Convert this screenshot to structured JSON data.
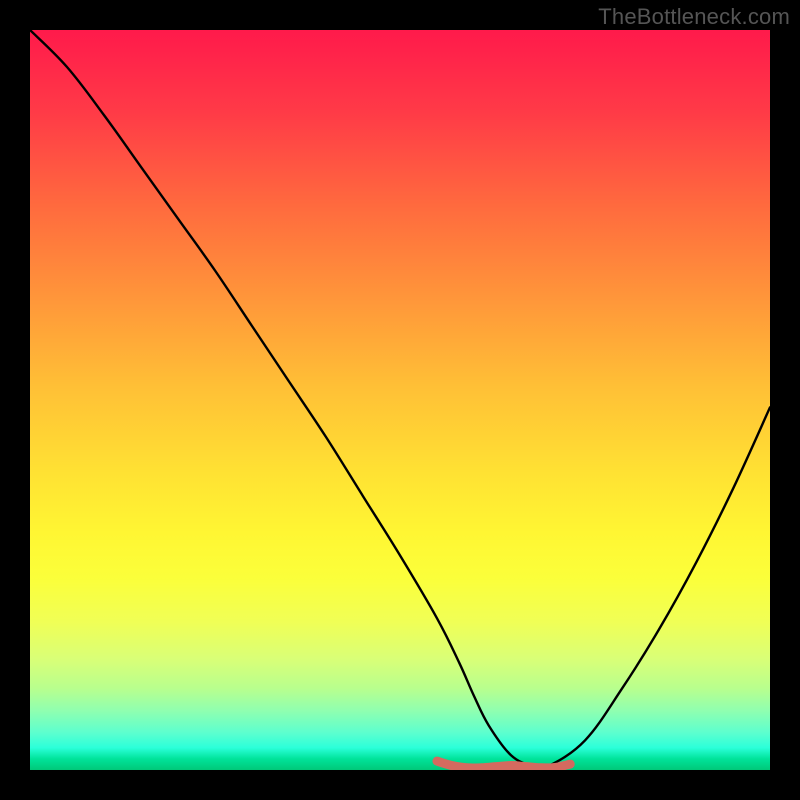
{
  "watermark": "TheBottleneck.com",
  "chart_data": {
    "type": "line",
    "title": "",
    "xlabel": "",
    "ylabel": "",
    "xlim": [
      0,
      100
    ],
    "ylim": [
      0,
      100
    ],
    "grid": false,
    "legend": false,
    "series": [
      {
        "name": "bottleneck-curve",
        "stroke": "#000000",
        "x": [
          0,
          5,
          10,
          15,
          20,
          25,
          30,
          35,
          40,
          45,
          50,
          55,
          58,
          60,
          62,
          65,
          68,
          70,
          75,
          80,
          85,
          90,
          95,
          100
        ],
        "y": [
          100,
          95,
          88.5,
          81.5,
          74.5,
          67.5,
          60,
          52.5,
          45,
          37,
          29,
          20.5,
          14.5,
          10,
          6,
          2,
          0.5,
          0.5,
          4,
          11,
          19,
          28,
          38,
          49
        ]
      },
      {
        "name": "optimal-band",
        "stroke": "#d46a5f",
        "x": [
          55,
          57,
          59,
          61,
          63,
          65,
          67,
          69,
          71,
          73
        ],
        "y": [
          1.2,
          0.6,
          0.3,
          0.3,
          0.45,
          0.6,
          0.45,
          0.3,
          0.35,
          0.8
        ]
      }
    ],
    "background_gradient": {
      "top_color": "#ff1a4b",
      "bottom_color": "#00c878",
      "description": "red-to-green vertical gradient indicating bottleneck severity (red high, green low)"
    }
  }
}
